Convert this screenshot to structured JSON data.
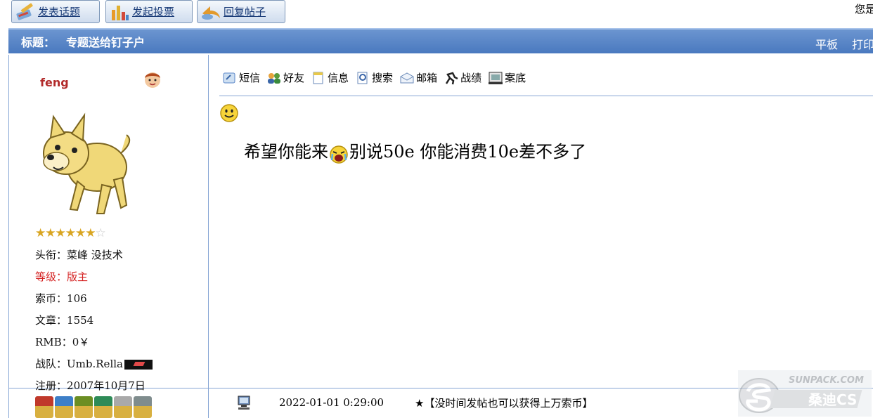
{
  "topbar": {
    "buttons": [
      {
        "label": "发表话题",
        "icon": "pen-icon"
      },
      {
        "label": "发起投票",
        "icon": "bar-chart-icon"
      },
      {
        "label": "回复帖子",
        "icon": "reply-icon"
      }
    ],
    "welcome": "您是"
  },
  "titlebar": {
    "label": "标题：",
    "title": "专题送给钉子户",
    "tools": [
      "平板",
      "打印"
    ]
  },
  "author": {
    "name": "feng",
    "rating": {
      "filled": 6,
      "total": 7
    },
    "lines": [
      {
        "key": "头衔",
        "value": "菜峰 没技术"
      },
      {
        "key": "等级",
        "value": "版主"
      },
      {
        "key": "索币",
        "value": "106"
      },
      {
        "key": "文章",
        "value": "1554"
      },
      {
        "key": "RMB",
        "value": "0￥"
      },
      {
        "key": "战队",
        "value": "Umb.Rella"
      },
      {
        "key": "注册",
        "value": "2007年10月7日"
      }
    ],
    "medal_colors": [
      "#c0392b",
      "#3d7fc7",
      "#6b8e23",
      "#2e8b57",
      "#a9a9a9",
      "#7f8c8d"
    ]
  },
  "post": {
    "tools": [
      {
        "label": "短信",
        "icon": "message-icon"
      },
      {
        "label": "好友",
        "icon": "friends-icon"
      },
      {
        "label": "信息",
        "icon": "info-icon"
      },
      {
        "label": "搜索",
        "icon": "search-icon"
      },
      {
        "label": "邮箱",
        "icon": "mail-icon"
      },
      {
        "label": "战绩",
        "icon": "runner-icon"
      },
      {
        "label": "案底",
        "icon": "record-icon"
      }
    ],
    "body_before": "希望你能来",
    "body_after": "别说50e 你能消费10e差不多了",
    "timestamp": "2022-01-01 0:29:00",
    "footer_link": "★【没时间发帖也可以获得上万索币】"
  },
  "watermark": {
    "url_text": "SUNPACK.COM",
    "brand": "桑迪CS"
  },
  "colors": {
    "title_bar": "#5a86c8",
    "border": "#86a5d4",
    "author_name": "#b22a2a",
    "level_red": "#d42020"
  }
}
